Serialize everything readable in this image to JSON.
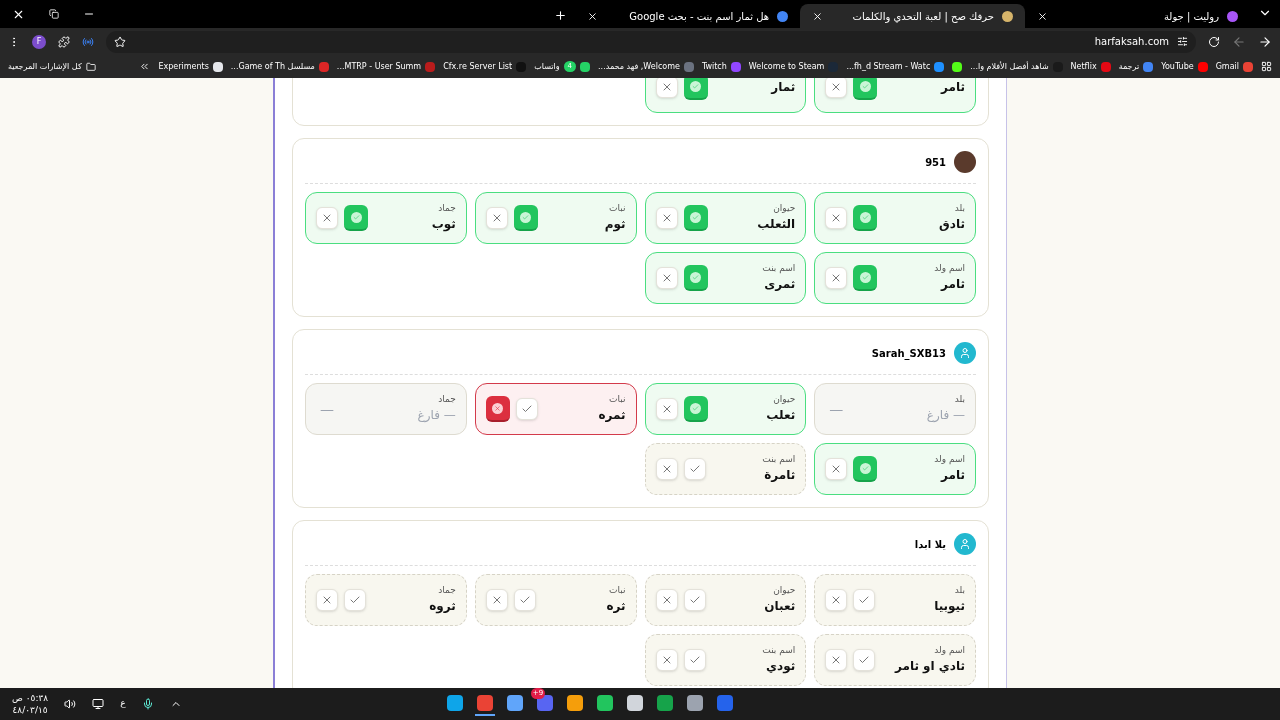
{
  "tabs": [
    {
      "title": "روليت | جولة",
      "selected": false,
      "color": "#a855f7"
    },
    {
      "title": "حرفك صح | لعبة التحدي والكلمات",
      "selected": true,
      "color": "#d6b46a"
    },
    {
      "title": "هل ثمار اسم بنت - بحث Google",
      "selected": false,
      "color": "#4285f4"
    }
  ],
  "address_bar": {
    "url": "harfaksah.com"
  },
  "profile": {
    "initial": "F"
  },
  "bookmarks": [
    {
      "label": "Gmail",
      "color": "#ea4335"
    },
    {
      "label": "YouTube",
      "color": "#ff0000"
    },
    {
      "label": "ترجمة",
      "color": "#4285f4"
    },
    {
      "label": "Netflix",
      "color": "#e50914"
    },
    {
      "label": "شاهد أفضل الأفلام وا...",
      "color": "#1a1a1a"
    },
    {
      "color": "#53fc18"
    },
    {
      "label": "fh_d Stream - Watc...",
      "color": "#1e90ff"
    },
    {
      "label": "Welcome to Steam",
      "color": "#1b2838"
    },
    {
      "label": "Twitch",
      "color": "#9146ff"
    },
    {
      "label": "Welcome, فهد محمد...",
      "color": "#6b7280"
    },
    {
      "label": "واتساب",
      "color": "#25d366",
      "badge": "4"
    },
    {
      "label": "Cfx.re Server List",
      "color": "#111111"
    },
    {
      "label": "MTRP - User Summ...",
      "color": "#b91c1c"
    },
    {
      "label": "مسلسل Game of Th...",
      "color": "#dc2626"
    },
    {
      "label": "Experiments",
      "color": "#e5e7eb"
    }
  ],
  "all_bookmarks": "كل الإشارات المرجعية",
  "previous_card": {
    "answers": [
      {
        "answer": "ثامر",
        "kind": "correct"
      },
      {
        "answer": "ثمار",
        "kind": "correct"
      }
    ]
  },
  "players": [
    {
      "name": "951",
      "avatar": {
        "kind": "photo"
      },
      "answers": [
        {
          "category": "بلد",
          "answer": "ثادق",
          "kind": "correct"
        },
        {
          "category": "حيوان",
          "answer": "الثعلب",
          "kind": "correct"
        },
        {
          "category": "نبات",
          "answer": "ثوم",
          "kind": "correct"
        },
        {
          "category": "جماد",
          "answer": "ثوب",
          "kind": "correct"
        },
        {
          "category": "اسم ولد",
          "answer": "ثامر",
          "kind": "correct"
        },
        {
          "category": "اسم بنت",
          "answer": "ثمرى",
          "kind": "correct"
        }
      ]
    },
    {
      "name": "Sarah_SXB13",
      "avatar": {
        "kind": "icon"
      },
      "answers": [
        {
          "category": "بلد",
          "answer": "— فارغ",
          "kind": "empty",
          "side_text": "—"
        },
        {
          "category": "حيوان",
          "answer": "ثعلب",
          "kind": "correct"
        },
        {
          "category": "نبات",
          "answer": "ثمره",
          "kind": "wrong"
        },
        {
          "category": "جماد",
          "answer": "— فارغ",
          "kind": "empty",
          "side_text": "—"
        },
        {
          "category": "اسم ولد",
          "answer": "ثامر",
          "kind": "correct"
        },
        {
          "category": "اسم بنت",
          "answer": "ثامرة",
          "kind": "pending"
        }
      ]
    },
    {
      "name": "يلا ابدا",
      "avatar": {
        "kind": "icon"
      },
      "answers": [
        {
          "category": "بلد",
          "answer": "ثيوبيا",
          "kind": "pending"
        },
        {
          "category": "حيوان",
          "answer": "ثعبان",
          "kind": "pending"
        },
        {
          "category": "نبات",
          "answer": "ثره",
          "kind": "pending"
        },
        {
          "category": "جماد",
          "answer": "ثروه",
          "kind": "pending"
        },
        {
          "category": "اسم ولد",
          "answer": "ثادي او ثامر",
          "kind": "pending"
        },
        {
          "category": "اسم بنت",
          "answer": "ثودي",
          "kind": "pending"
        }
      ]
    }
  ],
  "taskbar": {
    "time": "٠٥:٣٨ ص",
    "date": "٤٨/٠٣/١٥",
    "language": "ع",
    "apps": [
      {
        "color": "#2563eb",
        "selected": false
      },
      {
        "color": "#9ca3af",
        "selected": false
      },
      {
        "color": "#16a34a",
        "selected": false
      },
      {
        "color": "#d1d5db",
        "selected": false
      },
      {
        "color": "#22c55e",
        "selected": false
      },
      {
        "color": "#f59e0b",
        "selected": false
      },
      {
        "color": "#5865f2",
        "badge": "9+",
        "selected": false
      },
      {
        "color": "#60a5fa",
        "selected": false
      },
      {
        "color": "#ea4335",
        "selected": true
      },
      {
        "color": "#0ea5e9",
        "selected": false
      }
    ]
  }
}
